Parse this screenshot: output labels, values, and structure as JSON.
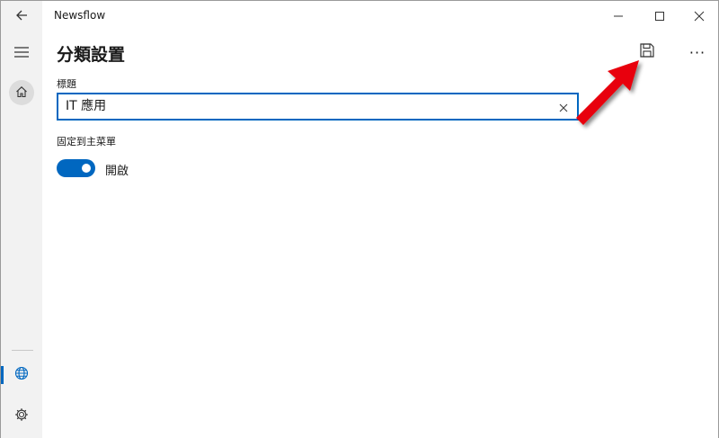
{
  "window": {
    "app_title": "Newsflow"
  },
  "titlebar": {
    "back_icon": "arrow-left-icon",
    "minimize_icon": "minimize-icon",
    "maximize_icon": "maximize-icon",
    "close_icon": "close-icon"
  },
  "sidebar": {
    "items": [
      {
        "icon": "hamburger-icon"
      },
      {
        "icon": "home-icon"
      },
      {
        "icon": "globe-icon",
        "selected": true
      },
      {
        "icon": "gear-icon"
      }
    ]
  },
  "main": {
    "page_title": "分類設置",
    "save_icon": "save-icon",
    "more_label": "···",
    "title_field": {
      "label": "標題",
      "value": "IT 應用",
      "clear_icon": "close-icon"
    },
    "pin_field": {
      "label": "固定到主菜單",
      "toggle_on": true,
      "toggle_text": "開啟"
    }
  },
  "annotation": {
    "arrow_color": "#e8000b",
    "points_to": "save-button"
  },
  "colors": {
    "accent": "#0067c0",
    "sidebar_bg": "#f2f2f2"
  }
}
